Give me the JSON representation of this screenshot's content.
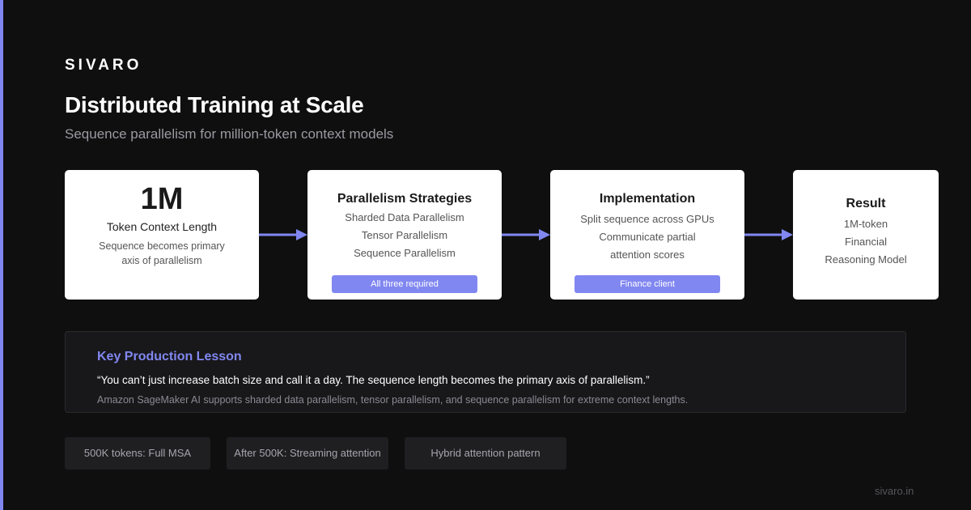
{
  "brand": "SIVARO",
  "header": {
    "title": "Distributed Training at Scale",
    "subtitle": "Sequence parallelism for million-token context models"
  },
  "colors": {
    "accent": "#8187f0",
    "background": "#0f0f0f",
    "card": "#ffffff",
    "panel": "#18181b"
  },
  "flow": {
    "card1": {
      "big": "1M",
      "label": "Token Context Length",
      "desc": [
        "Sequence becomes primary",
        "axis of parallelism"
      ]
    },
    "card2": {
      "title": "Parallelism Strategies",
      "lines": [
        "Sharded Data Parallelism",
        "Tensor Parallelism",
        "Sequence Parallelism"
      ],
      "pill": "All three required"
    },
    "card3": {
      "title": "Implementation",
      "lines": [
        "Split sequence across GPUs",
        "Communicate partial",
        "attention scores"
      ],
      "pill": "Finance client"
    },
    "card4": {
      "title": "Result",
      "lines": [
        "1M-token",
        "Financial",
        "Reasoning Model"
      ]
    }
  },
  "lesson": {
    "title": "Key Production Lesson",
    "quote": "“You can’t just increase batch size and call it a day. The sequence length becomes the primary axis of parallelism.”",
    "note": "Amazon SageMaker AI supports sharded data parallelism, tensor parallelism, and sequence parallelism for extreme context lengths."
  },
  "chips": [
    "500K tokens: Full MSA",
    "After 500K: Streaming attention",
    "Hybrid attention pattern"
  ],
  "footer": {
    "site": "sivaro.in"
  }
}
